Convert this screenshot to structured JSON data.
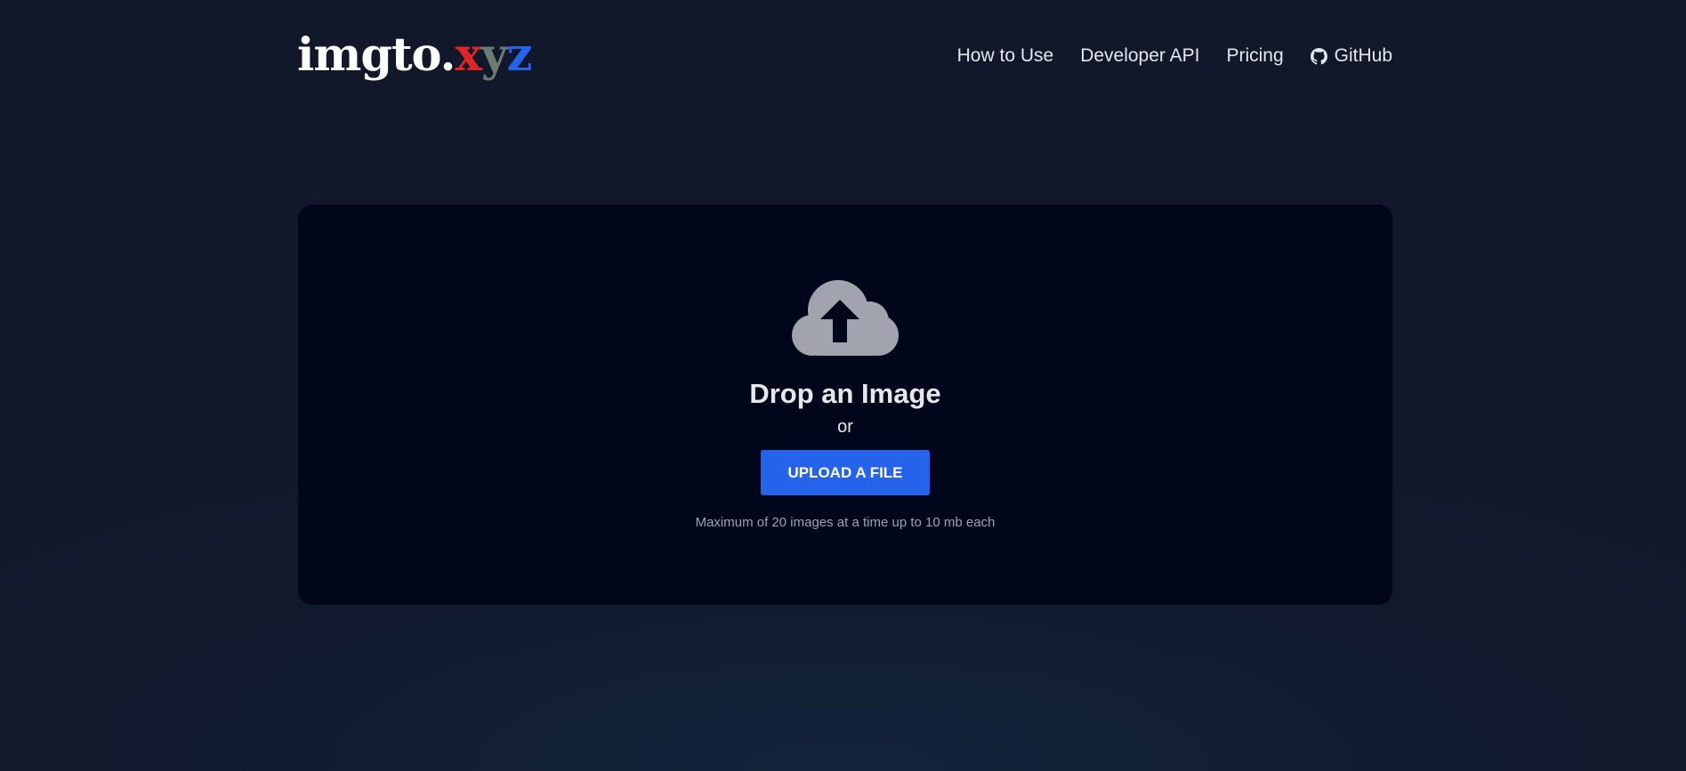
{
  "logo": {
    "base": "imgto.",
    "x": "x",
    "y": "y",
    "z": "z"
  },
  "nav": {
    "how_to_use": "How to Use",
    "developer_api": "Developer API",
    "pricing": "Pricing",
    "github": "GitHub",
    "github_icon": "github-icon"
  },
  "dropzone": {
    "icon": "cloud-upload-icon",
    "title": "Drop an Image",
    "or": "or",
    "upload_label": "UPLOAD A FILE",
    "limit_note": "Maximum of 20 images at a time up to 10 mb each"
  },
  "colors": {
    "background": "#111829",
    "dropzone": "#02061a",
    "accent": "#2563eb",
    "logo_x": "#dc2626",
    "logo_y": "#6b7c74",
    "logo_z": "#2563eb"
  }
}
